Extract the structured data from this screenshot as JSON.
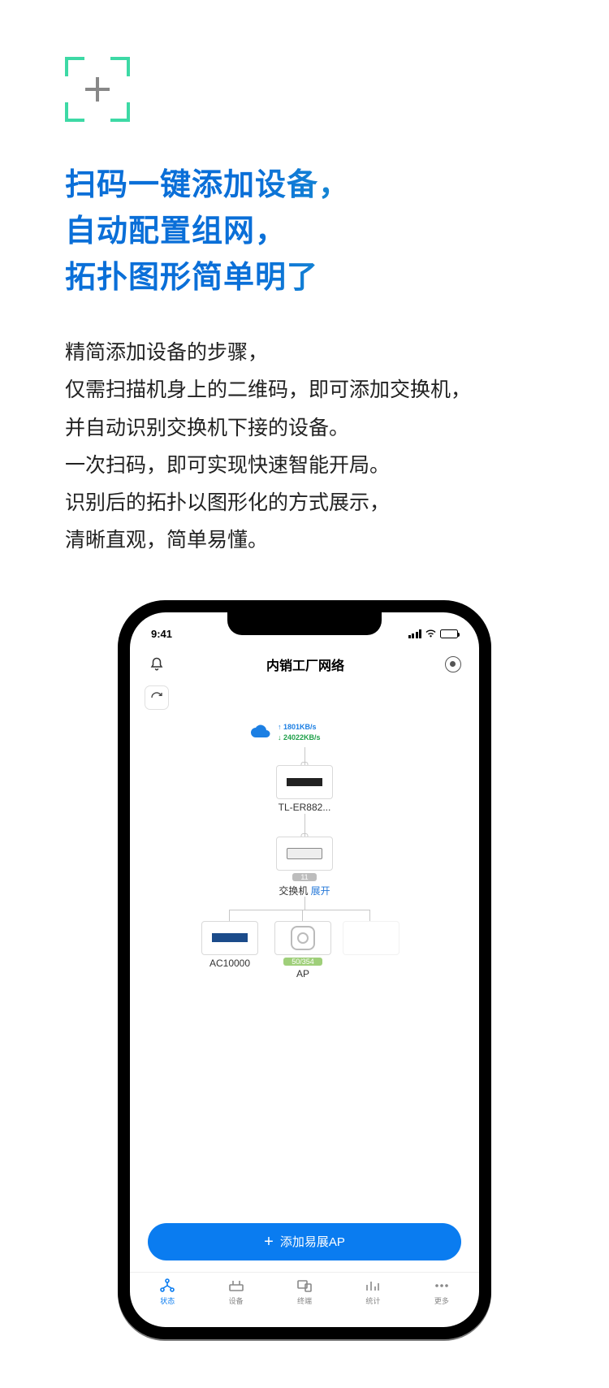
{
  "headline": {
    "line1": "扫码一键添加设备，",
    "line2": "自动配置组网，",
    "line3": "拓扑图形简单明了"
  },
  "paragraph": {
    "l1": "精简添加设备的步骤，",
    "l2": "仅需扫描机身上的二维码，即可添加交换机，",
    "l3": "并自动识别交换机下接的设备。",
    "l4": "一次扫码，即可实现快速智能开局。",
    "l5": "识别后的拓扑以图形化的方式展示，",
    "l6": "清晰直观，简单易懂。"
  },
  "phone": {
    "time": "9:41",
    "header_title": "内销工厂网络",
    "speed_up": "1801KB/s",
    "speed_down": "24022KB/s",
    "router_name": "TL-ER882...",
    "switch_label": "交换机",
    "switch_expand": "展开",
    "switch_count": "11",
    "ac_name": "AC10000",
    "ap_label": "AP",
    "ap_count": "50/354",
    "add_button": "添加易展AP",
    "tabs": {
      "status": "状态",
      "device": "设备",
      "terminal": "终端",
      "stats": "统计",
      "more": "更多"
    }
  }
}
